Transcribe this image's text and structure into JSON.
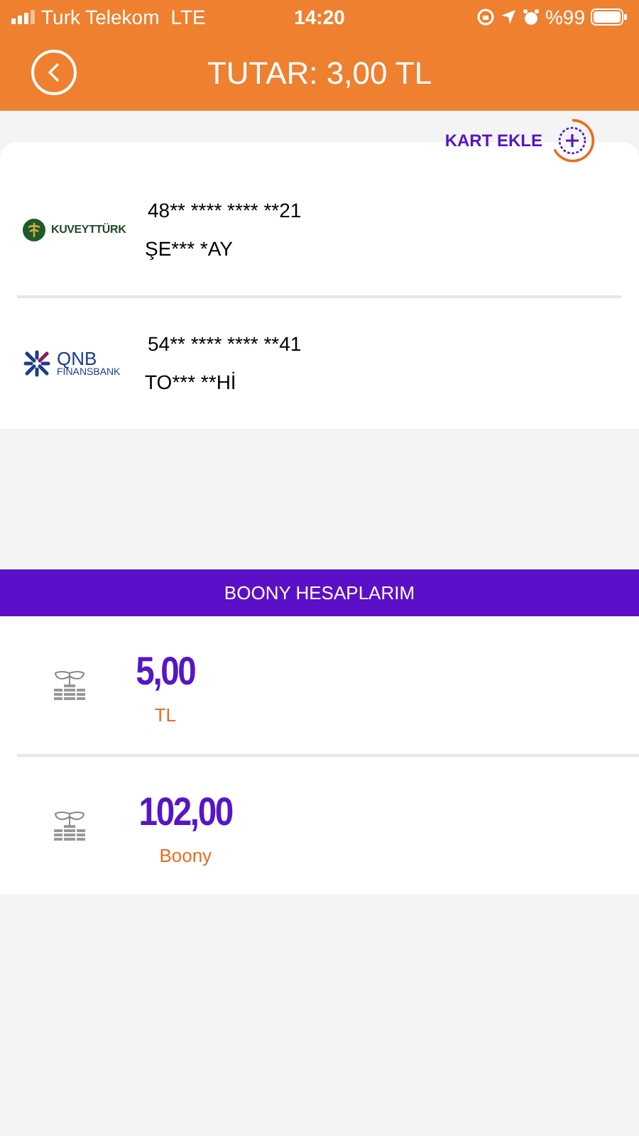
{
  "status_bar": {
    "carrier": "Turk Telekom",
    "network": "LTE",
    "time": "14:20",
    "battery": "%99"
  },
  "header": {
    "title": "TUTAR: 3,00 TL"
  },
  "add_card": {
    "label": "KART EKLE"
  },
  "cards": [
    {
      "kind": "kuveyt",
      "logo_text": [
        "KUVEYTTÜRK"
      ],
      "number": "48** **** **** **21",
      "holder": "ŞE*** *AY"
    },
    {
      "kind": "qnb",
      "logo_text": [
        "QNB",
        "FINANSBANK"
      ],
      "number": "54** **** **** **41",
      "holder": "TO*** **Hİ"
    }
  ],
  "accounts_header": "BOONY HESAPLARIM",
  "accounts": [
    {
      "amount": "5,00",
      "unit": "TL"
    },
    {
      "amount": "102,00",
      "unit": "Boony"
    }
  ]
}
